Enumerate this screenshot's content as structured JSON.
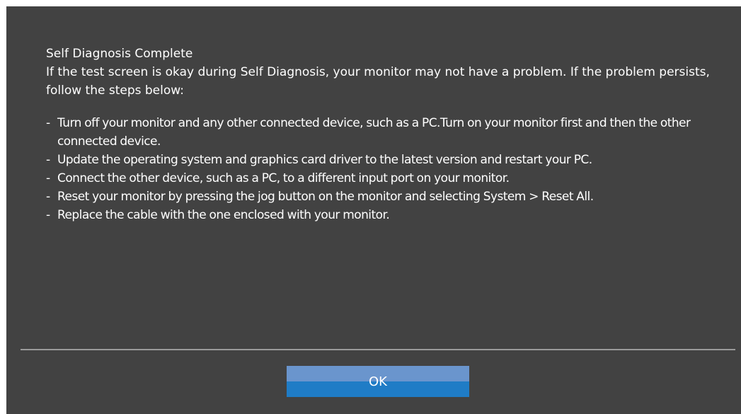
{
  "dialog": {
    "title": "Self Diagnosis Complete",
    "intro": "If the test screen is okay during Self Diagnosis, your monitor may not have a problem. If the problem persists, follow the steps below:",
    "steps": [
      "Turn off your monitor and any other connected device, such as a PC.Turn on your monitor first and then the other connected device.",
      "Update the operating system and graphics card driver to the latest version and restart your PC.",
      "Connect the other device, such as a PC, to a different input port on your monitor.",
      "Reset your monitor by pressing the jog button on the monitor and selecting System > Reset All.",
      "Replace the cable with the one enclosed with your monitor."
    ],
    "ok_label": "OK"
  },
  "colors": {
    "background": "#424242",
    "button_top": "#6a95cd",
    "button_bottom": "#1f7cc6"
  }
}
